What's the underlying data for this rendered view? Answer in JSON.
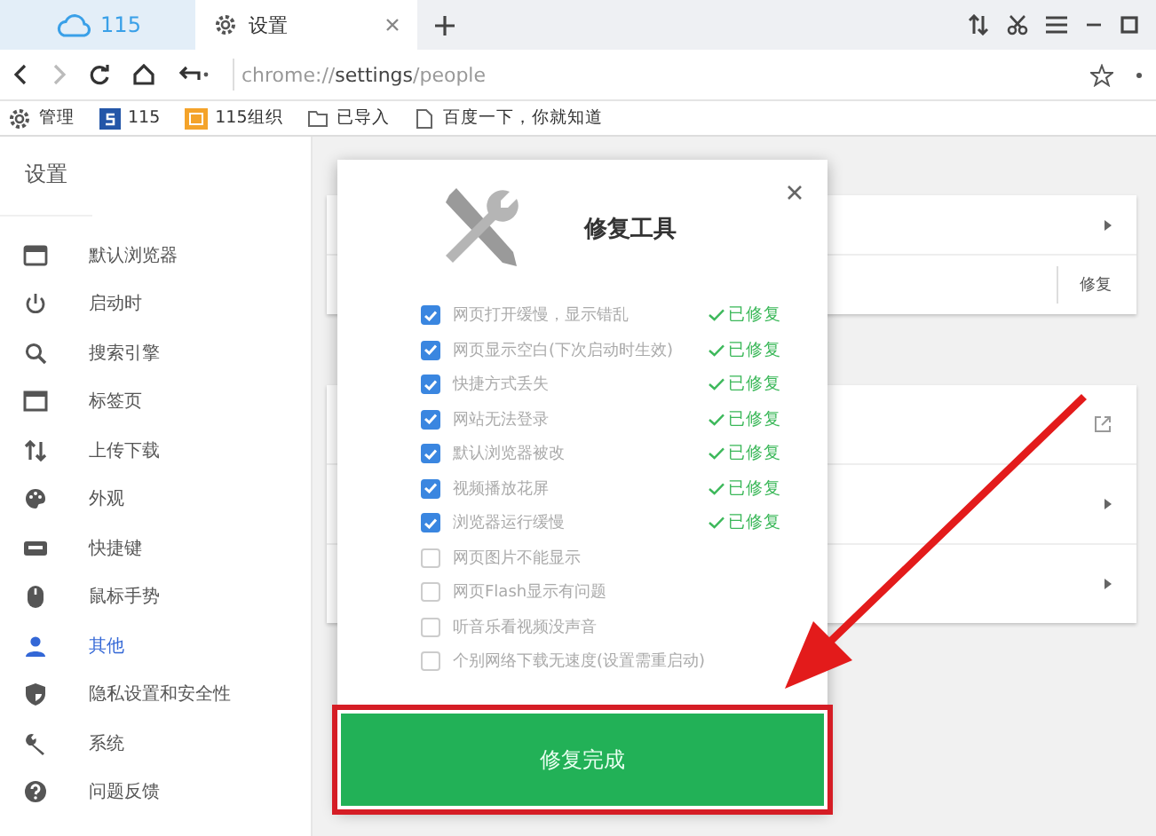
{
  "tabs": [
    {
      "label": "115",
      "kind": "cloud",
      "selected": false
    },
    {
      "label": "设置",
      "kind": "gear",
      "selected": true
    }
  ],
  "address_bar": {
    "url": "chrome://**settings**/people"
  },
  "bookmarks": [
    {
      "label": "管理",
      "kind": "gear"
    },
    {
      "label": "115",
      "kind": "s-logo"
    },
    {
      "label": "115组织",
      "kind": "org"
    },
    {
      "label": "已导入",
      "kind": "folder"
    },
    {
      "label": "百度一下，你就知道",
      "kind": "page"
    }
  ],
  "sidebar": {
    "title": "设置",
    "items": [
      {
        "label": "默认浏览器",
        "kind": "browser",
        "selected": false
      },
      {
        "label": "启动时",
        "kind": "power",
        "selected": false
      },
      {
        "label": "搜索引擎",
        "kind": "search",
        "selected": false
      },
      {
        "label": "标签页",
        "kind": "tab",
        "selected": false
      },
      {
        "label": "上传下载",
        "kind": "updown",
        "selected": false
      },
      {
        "label": "外观",
        "kind": "palette",
        "selected": false
      },
      {
        "label": "快捷键",
        "kind": "keyboard",
        "selected": false
      },
      {
        "label": "鼠标手势",
        "kind": "mouse",
        "selected": false
      },
      {
        "label": "其他",
        "kind": "person",
        "selected": true
      },
      {
        "label": "隐私设置和安全性",
        "kind": "shield",
        "selected": false
      },
      {
        "label": "系统",
        "kind": "wrench",
        "selected": false
      },
      {
        "label": "问题反馈",
        "kind": "help",
        "selected": false
      }
    ]
  },
  "cards": [
    {
      "rows": [
        {
          "kind": "chevron"
        },
        {
          "kind": "button",
          "button": "修复"
        }
      ]
    },
    {
      "rows": [
        {
          "kind": "external"
        },
        {
          "kind": "chevron"
        },
        {
          "kind": "chevron"
        }
      ]
    }
  ],
  "dialog": {
    "title": "修复工具",
    "items": [
      {
        "label": "网页打开缓慢，显示错乱",
        "checked": true,
        "status": "已修复"
      },
      {
        "label": "网页显示空白(下次启动时生效)",
        "checked": true,
        "status": "已修复"
      },
      {
        "label": "快捷方式丢失",
        "checked": true,
        "status": "已修复"
      },
      {
        "label": "网站无法登录",
        "checked": true,
        "status": "已修复"
      },
      {
        "label": "默认浏览器被改",
        "checked": true,
        "status": "已修复"
      },
      {
        "label": "视频播放花屏",
        "checked": true,
        "status": "已修复"
      },
      {
        "label": "浏览器运行缓慢",
        "checked": true,
        "status": "已修复"
      },
      {
        "label": "网页图片不能显示",
        "checked": false
      },
      {
        "label": "网页Flash显示有问题",
        "checked": false
      },
      {
        "label": "听音乐看视频没声音",
        "checked": false
      },
      {
        "label": "个别网络下载无速度(设置需重启动)",
        "checked": false
      }
    ],
    "confirm": "修复完成"
  }
}
